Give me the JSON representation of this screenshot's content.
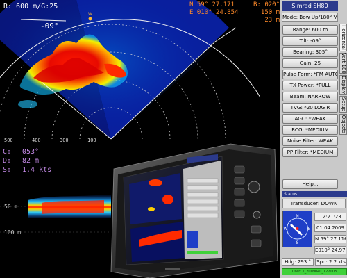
{
  "hud": {
    "range_mode": "R: 600 m/G:25",
    "tilt": "-09°",
    "position": {
      "lat_label": "N 59° 27.171",
      "lon_label": "E 010° 24.854",
      "b_label": "B:",
      "b_value": "020°",
      "dist_value": "150 m",
      "depth_value": "23 m"
    },
    "target": {
      "c_label": "C:",
      "c_value": "053°",
      "d_label": "D:",
      "d_value": "82 m",
      "s_label": "S:",
      "s_value": "1.4 kts"
    },
    "range_ticks": [
      "100",
      "200",
      "300",
      "400",
      "500"
    ],
    "north_marker": "W"
  },
  "vertical_strip": {
    "depth_labels": [
      "50 m",
      "100 m"
    ]
  },
  "panel": {
    "title": "Simrad SH80",
    "mode": "Mode: Bow Up/180° Vert.",
    "buttons": [
      {
        "label": "Range: 600 m"
      },
      {
        "label": "Tilt: -09°"
      },
      {
        "label": "Bearing: 305°"
      },
      {
        "label": "Gain: 25"
      },
      {
        "label": "Pulse Form: *FM AUTO"
      },
      {
        "label": "TX Power: *FULL"
      },
      {
        "label": "Beam: NARROW"
      },
      {
        "label": "TVG: *20 LOG R"
      },
      {
        "label": "AGC: *WEAK"
      },
      {
        "label": "RCG: *MEDIUM"
      },
      {
        "label": "Noise Filter: WEAK"
      },
      {
        "label": "PP Filter: *MEDIUM"
      }
    ],
    "help_label": "Help...",
    "tabs": [
      {
        "label": "Horizontal",
        "active": true
      },
      {
        "label": "Vert 180"
      },
      {
        "label": "Display"
      },
      {
        "label": "Setup"
      },
      {
        "label": "Objects"
      }
    ],
    "status_title": "Status",
    "transducer": "Transducer: DOWN",
    "time": "12:21:23",
    "date": "01.04.2009",
    "lat": "N 59° 27.116",
    "lon": "E010° 24.971",
    "heading": "Hdg: 293 °",
    "speed": "Spd: 2.2 kts",
    "file_bar": "User: 1_2009040_122008"
  },
  "colors": {
    "panel_bg": "#c9c9c9",
    "title_blue": "#2b3a8c",
    "position_text": "#ff8a2a",
    "target_text": "#c58be8",
    "status_green": "#3fd13a"
  }
}
